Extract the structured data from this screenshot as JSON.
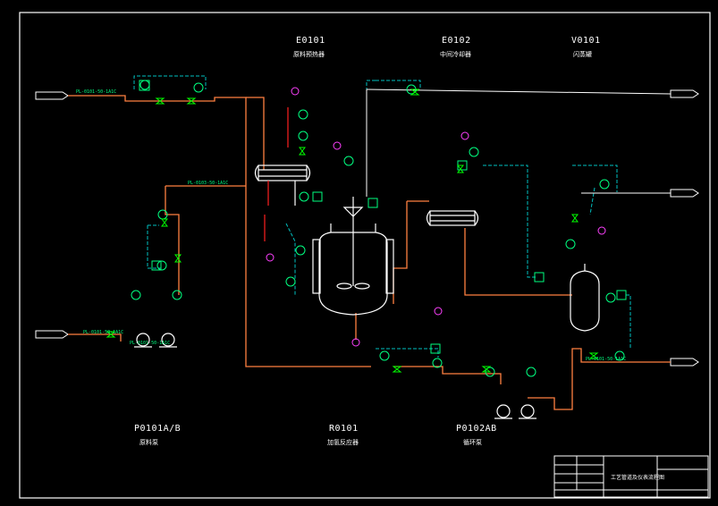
{
  "equipment_tags": {
    "e0101": "E0101",
    "e0102": "E0102",
    "v0101": "V0101",
    "p0101": "P0101A/B",
    "r0101": "R0101",
    "p0102": "P0102AB"
  },
  "equipment_names": {
    "e0101": "原料预热器",
    "e0102": "中间冷却器",
    "v0101": "闪蒸罐",
    "p0101": "原料泵",
    "r0101": "加氢反应器",
    "p0102": "循环泵"
  },
  "title_block": {
    "drawing_title": "工艺管道及仪表流程图"
  },
  "colors": {
    "process": "#ff8040",
    "utility": "#ffffff",
    "signal": "#00c0c0",
    "valve": "#00ff00",
    "instrument": "#00ff80",
    "relief": "#ff40ff",
    "hot": "#ff2020",
    "equipment": "#ffffff"
  }
}
